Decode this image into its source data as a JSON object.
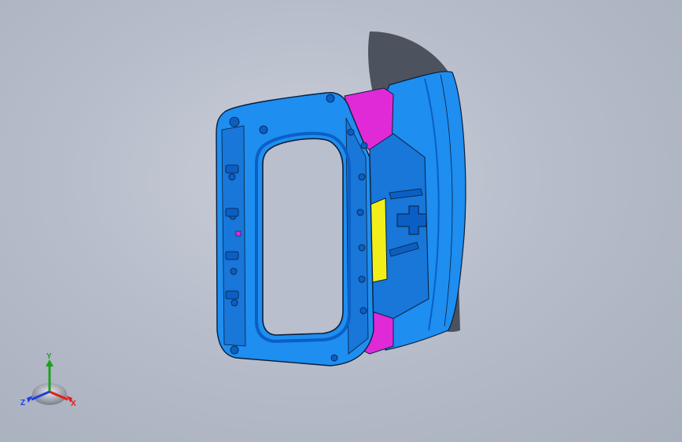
{
  "viewport": {
    "background_top": "#c9ced9",
    "background_bottom": "#a8afbd"
  },
  "model": {
    "body_color": "#1e8ef0",
    "body_dark": "#0b5fc4",
    "edge_color": "#0a1e3c",
    "bracket_color": "#e02ad8",
    "insert_color": "#f2ee1a",
    "shadow_color": "#3a3f4a"
  },
  "triad": {
    "x_label": "X",
    "y_label": "Y",
    "z_label": "Z",
    "x_color": "#e01e1e",
    "y_color": "#1ea01e",
    "z_color": "#1e3ee0"
  }
}
